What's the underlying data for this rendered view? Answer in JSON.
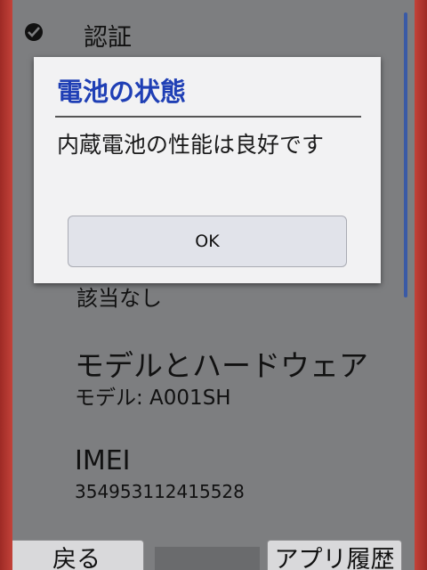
{
  "background_rows": {
    "auth_label": "認証",
    "auth_sub": "該当なし",
    "model_title": "モデルとハードウェア",
    "model_value": "モデル: A001SH",
    "imei_title": "IMEI",
    "imei_value": "354953112415528"
  },
  "dialog": {
    "title": "電池の状態",
    "message": "内蔵電池の性能は良好です",
    "ok_label": "OK"
  },
  "nav": {
    "back_label": "戻る",
    "history_label": "アプリ履歴"
  },
  "colors": {
    "dialog_title": "#1f3fb5",
    "phone_body": "#b5362f"
  },
  "icons": {
    "auth": "check-circle-icon"
  }
}
